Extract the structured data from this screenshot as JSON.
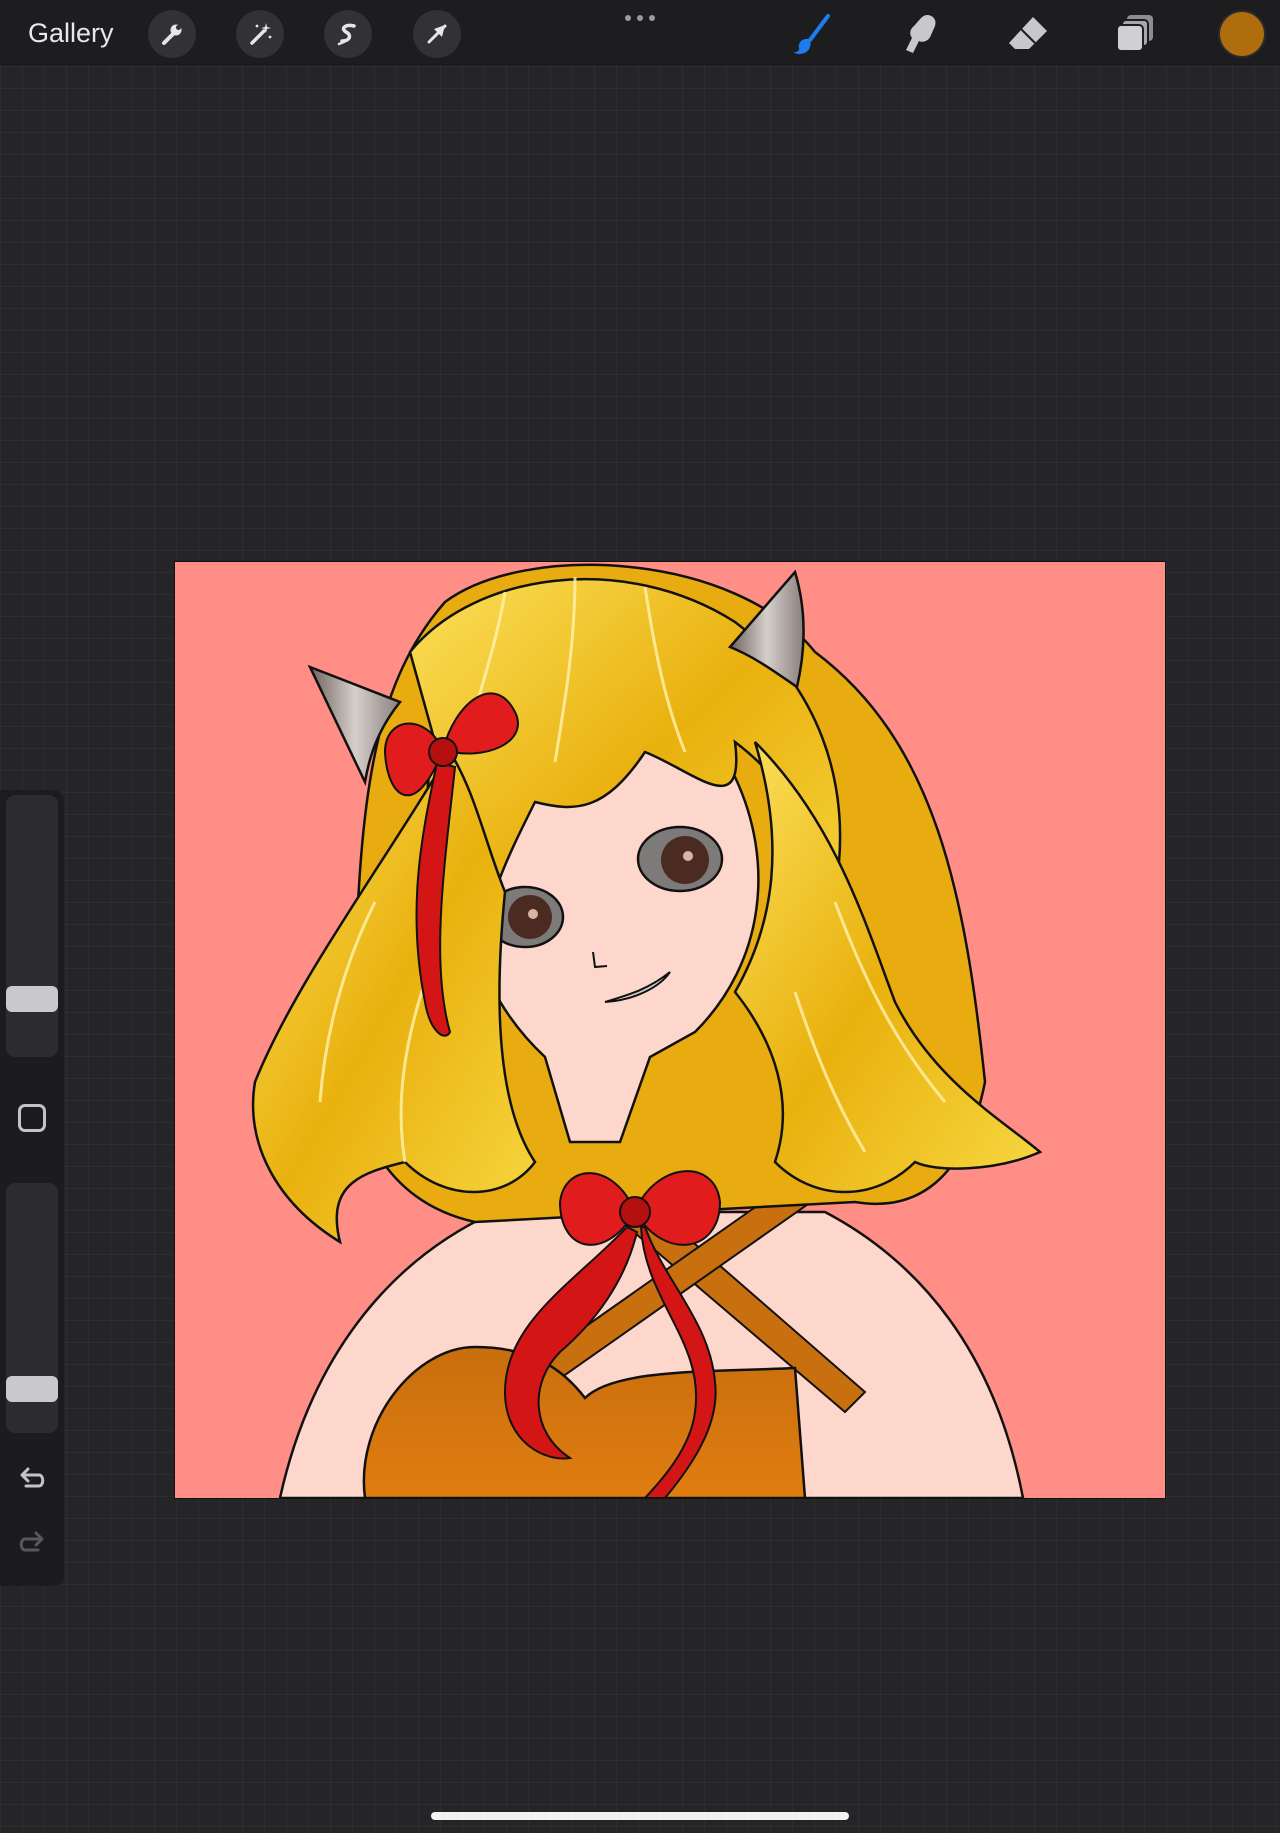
{
  "topbar": {
    "gallery_label": "Gallery",
    "left_tools": [
      {
        "name": "actions",
        "icon": "wrench-icon"
      },
      {
        "name": "adjustments",
        "icon": "magic-wand-icon"
      },
      {
        "name": "selection",
        "icon": "selection-s-icon"
      },
      {
        "name": "transform",
        "icon": "arrow-cursor-icon"
      }
    ],
    "more_menu_icon": "more-dots-icon",
    "right_tools": [
      {
        "name": "brush",
        "icon": "brush-icon",
        "active": true
      },
      {
        "name": "smudge",
        "icon": "smudge-finger-icon",
        "active": false
      },
      {
        "name": "eraser",
        "icon": "eraser-icon",
        "active": false
      },
      {
        "name": "layers",
        "icon": "layers-icon",
        "active": false
      }
    ],
    "current_color": "#b06d0d"
  },
  "sidebar": {
    "brush_size_level": 0.19,
    "opacity_level": 0.14,
    "modify_icon": "square-icon",
    "undo_icon": "undo-arrow-icon",
    "redo_icon": "redo-arrow-icon"
  },
  "canvas": {
    "background_color": "#ff8e86",
    "artwork": "artwork-illustration"
  },
  "colors": {
    "accent": "#1e7cf0",
    "hair": "#f2c21a",
    "skin": "#fdd7cb",
    "dress": "#d97a10",
    "ribbon": "#e01c1c"
  }
}
